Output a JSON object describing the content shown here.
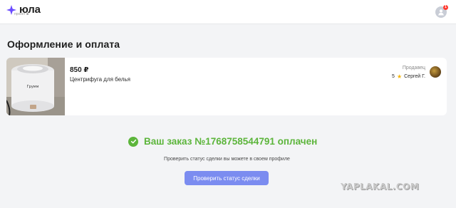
{
  "header": {
    "logo_text": "юла",
    "logo_sub": "проект ■",
    "notification_count": "1",
    "brand_color": "#6a4bff"
  },
  "page": {
    "title": "Оформление и оплата"
  },
  "order_item": {
    "price": "850 ₽",
    "name": "Центрифуга для белья",
    "seller_label": "Продавец",
    "seller_rating": "5",
    "seller_name": "Сергей Г.",
    "image_text": "Грумм"
  },
  "success": {
    "message": "Ваш заказ №1768758544791 оплачен",
    "color": "#5cb53b",
    "hint": "Проверить статус сделки вы можете в своем профиле",
    "button_label": "Проверить статус сделки",
    "button_color": "#7b8cf0"
  },
  "watermark": "YAPLAKAL.COM",
  "icons": {
    "logo": "star-logo-icon",
    "user": "user-icon",
    "check": "check-circle-icon",
    "star": "star-icon"
  }
}
